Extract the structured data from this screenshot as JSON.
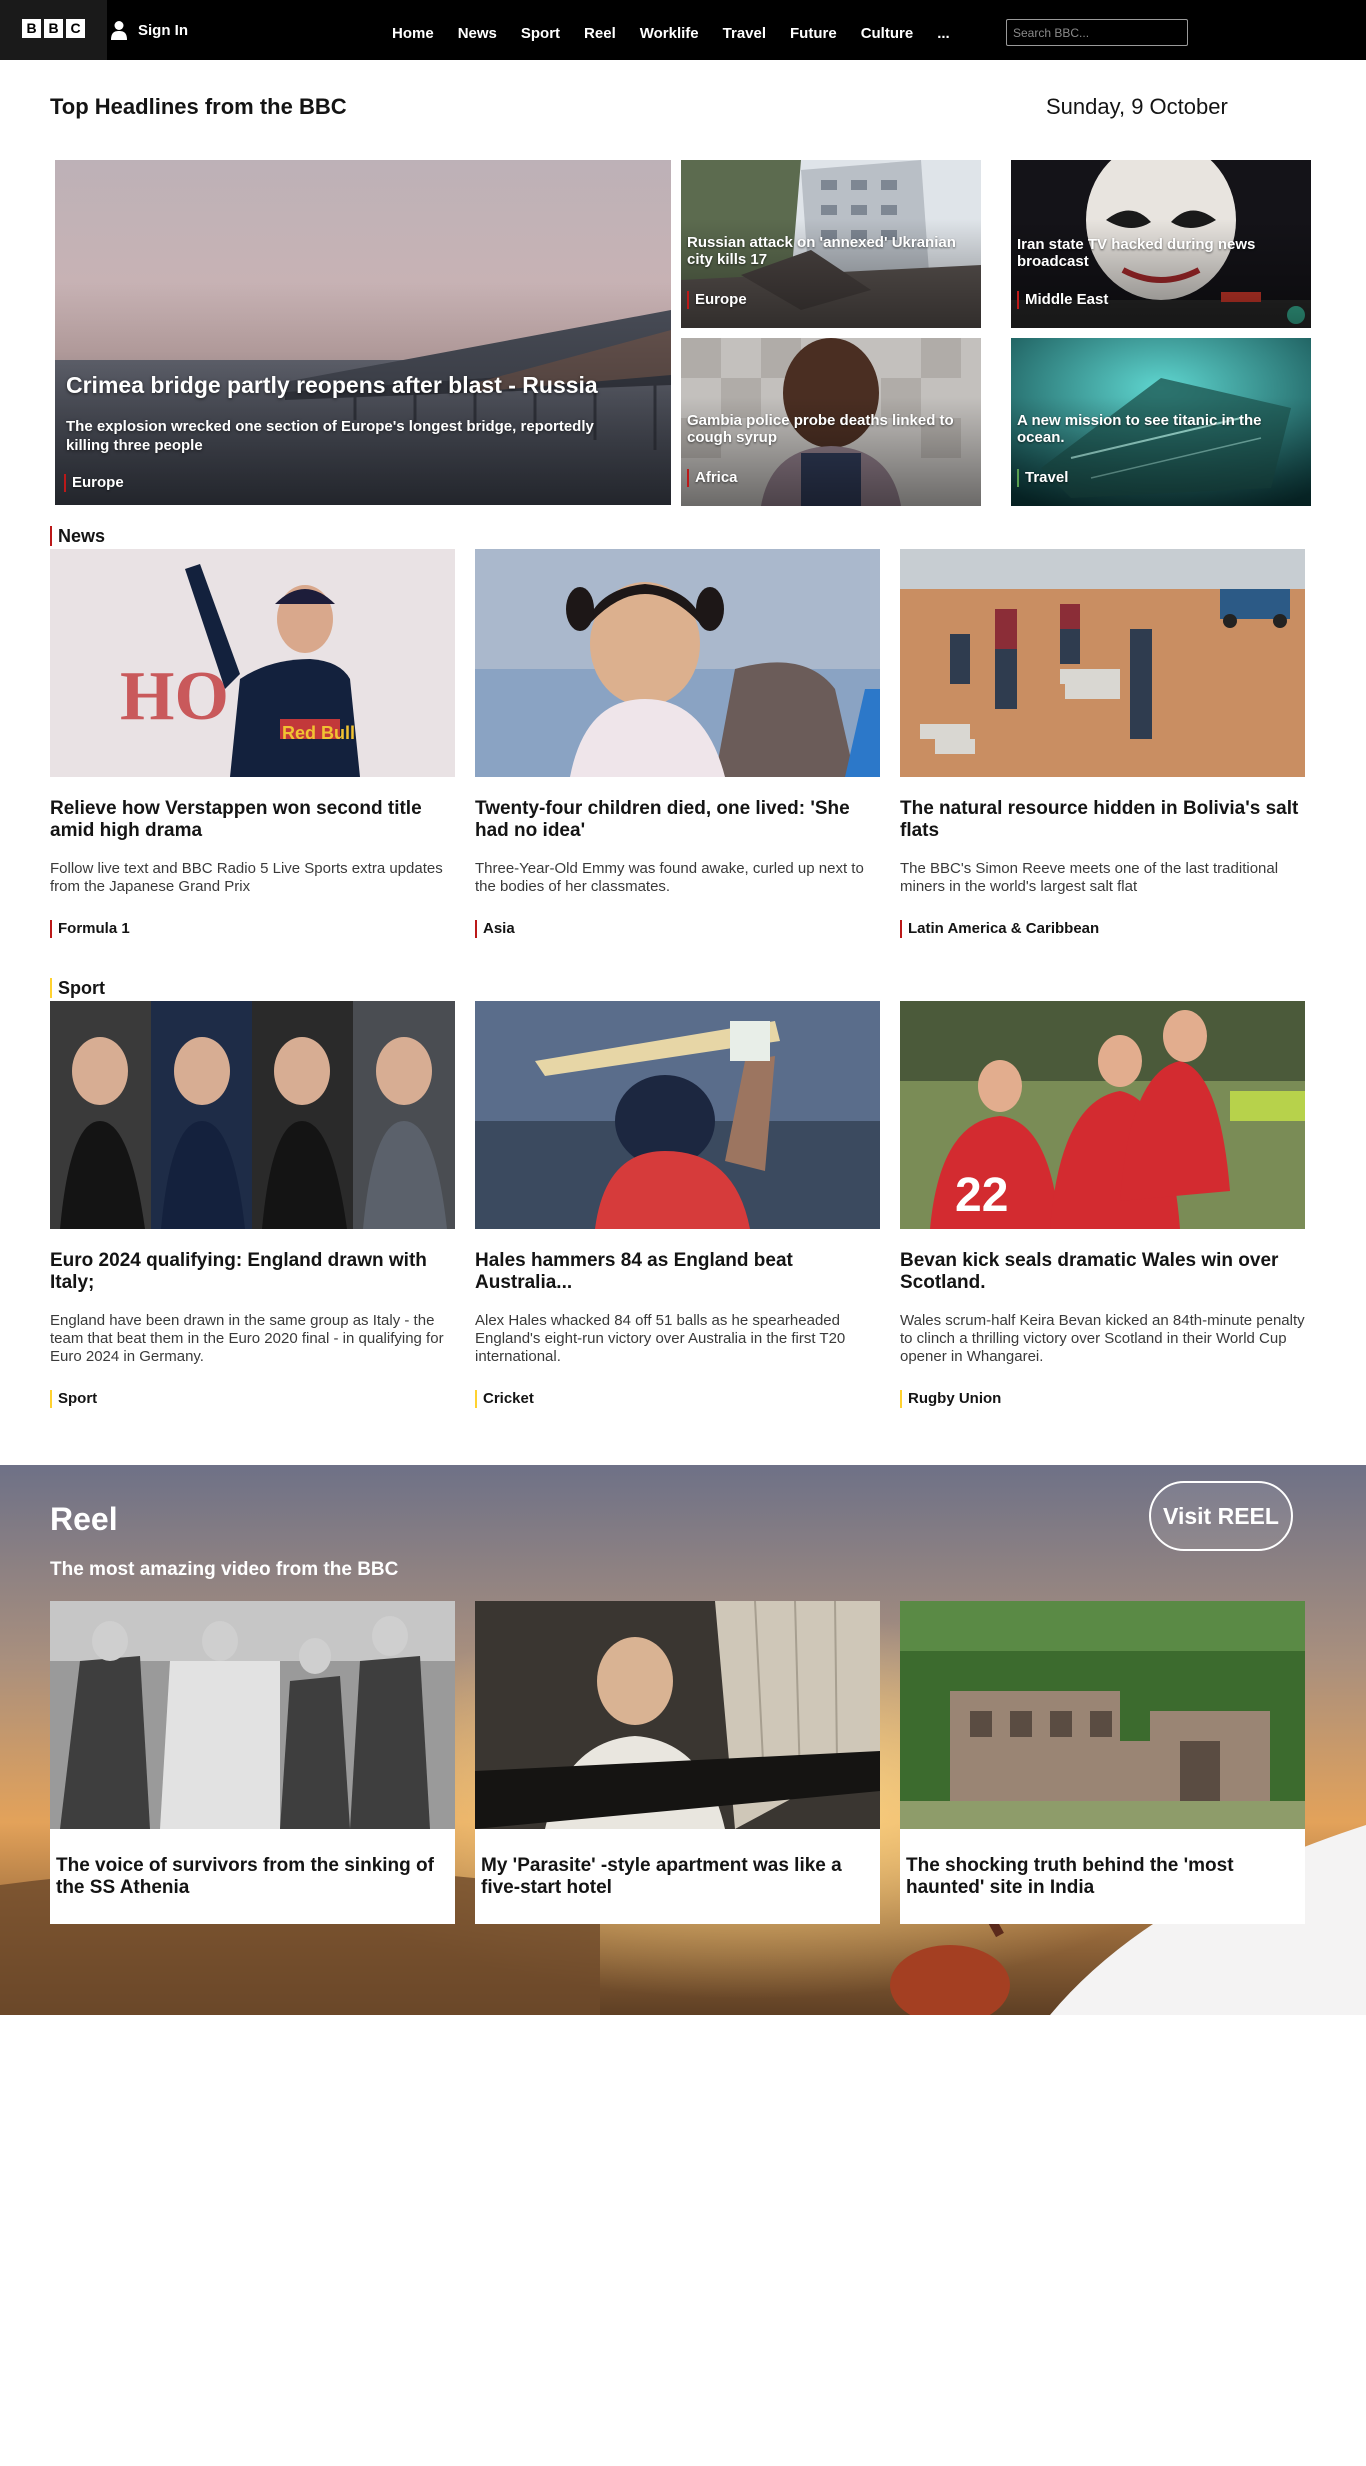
{
  "nav": {
    "logo_letters": [
      "B",
      "B",
      "C"
    ],
    "signin_label": "Sign In",
    "links": [
      "Home",
      "News",
      "Sport",
      "Reel",
      "Worklife",
      "Travel",
      "Future",
      "Culture",
      "..."
    ],
    "search_placeholder": "Search BBC..."
  },
  "page": {
    "title": "Top Headlines from the BBC",
    "date": "Sunday, 9 October"
  },
  "headlines": {
    "main": {
      "title": "Crimea bridge partly reopens after blast - Russia",
      "summary": "The explosion wrecked one section of Europe's longest bridge, reportedly killing three people",
      "tag": "Europe"
    },
    "tiles": [
      {
        "title": "Russian attack on 'annexed' Ukranian city kills 17",
        "tag": "Europe"
      },
      {
        "title": "Iran state TV hacked during news broadcast",
        "tag": "Middle East"
      },
      {
        "title": "Gambia police probe deaths linked to cough syrup",
        "tag": "Africa"
      },
      {
        "title": "A new mission to see titanic in the ocean.",
        "tag": "Travel"
      }
    ]
  },
  "news": {
    "heading": "News",
    "cards": [
      {
        "title": "Relieve how Verstappen won second title amid high drama",
        "summary": "Follow live text and BBC Radio 5 Live Sports extra updates from the Japanese Grand Prix",
        "tag": "Formula 1"
      },
      {
        "title": "Twenty-four children died, one lived: 'She had no idea'",
        "summary": "Three-Year-Old Emmy was found awake, curled up next to the bodies of her classmates.",
        "tag": "Asia"
      },
      {
        "title": "The natural resource hidden in Bolivia's salt flats",
        "summary": "The BBC's Simon Reeve meets one of the last traditional miners in the world's largest salt flat",
        "tag": "Latin America & Caribbean"
      }
    ]
  },
  "sport": {
    "heading": "Sport",
    "cards": [
      {
        "title": "Euro 2024 qualifying: England drawn with Italy;",
        "summary": "England have been drawn in the same group as Italy - the team that beat them in the Euro 2020 final - in qualifying for Euro 2024 in Germany.",
        "tag": "Sport"
      },
      {
        "title": "Hales hammers 84 as England beat Australia...",
        "summary": "Alex Hales whacked 84 off 51 balls as he spearheaded England's eight-run victory over Australia in the first T20 international.",
        "tag": "Cricket"
      },
      {
        "title": "Bevan kick seals dramatic Wales win over Scotland.",
        "summary": "Wales scrum-half Keira Bevan kicked an 84th-minute penalty to clinch a thrilling victory over Scotland in their World Cup opener in Whangarei.",
        "tag": "Rugby Union"
      }
    ]
  },
  "reel": {
    "title": "Reel",
    "subtitle": "The most amazing video from the BBC",
    "button": "Visit REEL",
    "cards": [
      {
        "title": "The voice of survivors from the sinking of the SS Athenia"
      },
      {
        "title": "My 'Parasite' -style apartment was like a five-start hotel"
      },
      {
        "title": "The shocking truth behind the 'most haunted' site in India"
      }
    ]
  },
  "colors": {
    "news_accent": "#bb1919",
    "sport_accent": "#ffd230",
    "travel_accent": "#589e50",
    "nav_bg": "#000000"
  }
}
